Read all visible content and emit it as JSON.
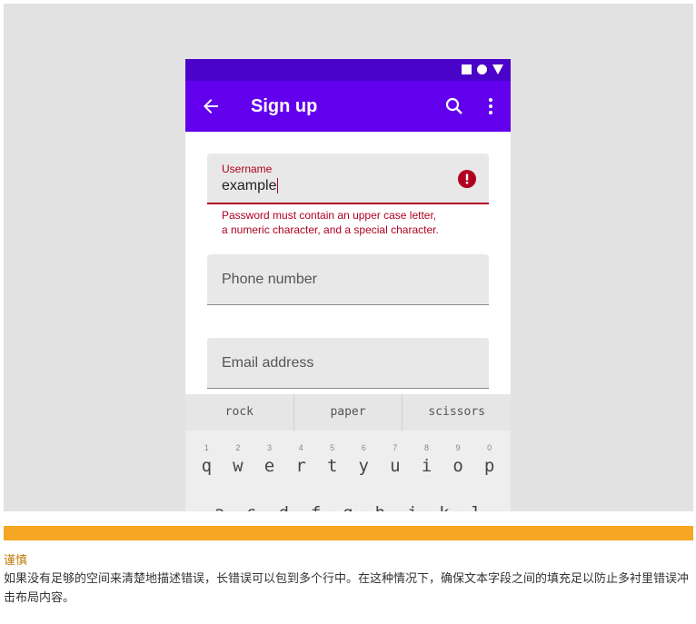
{
  "colors": {
    "statusbar": "#4a03c9",
    "appbar": "#6200ee",
    "error": "#b00020",
    "banner": "#f5a623",
    "caution_title": "#c07a0a"
  },
  "appbar": {
    "title": "Sign up",
    "back_icon": "arrow-left-icon",
    "search_icon": "search-icon",
    "more_icon": "more-vert-icon"
  },
  "form": {
    "username": {
      "label": "Username",
      "value": "example",
      "helper_line1": "Password must contain an upper case letter,",
      "helper_line2": "a numeric character, and a special character."
    },
    "phone": {
      "placeholder": "Phone number"
    },
    "email": {
      "placeholder": "Email address"
    }
  },
  "keyboard": {
    "suggestions": [
      "rock",
      "paper",
      "scissors"
    ],
    "numbers": [
      "1",
      "2",
      "3",
      "4",
      "5",
      "6",
      "7",
      "8",
      "9",
      "0"
    ],
    "row1": [
      "q",
      "w",
      "e",
      "r",
      "t",
      "y",
      "u",
      "i",
      "o",
      "p"
    ],
    "row2": [
      "a",
      "s",
      "d",
      "f",
      "g",
      "h",
      "j",
      "k",
      "l"
    ]
  },
  "caution": {
    "title": "谨慎",
    "body": "如果没有足够的空间来清楚地描述错误，长错误可以包到多个行中。在这种情况下，确保文本字段之间的填充足以防止多衬里错误冲击布局内容。"
  }
}
